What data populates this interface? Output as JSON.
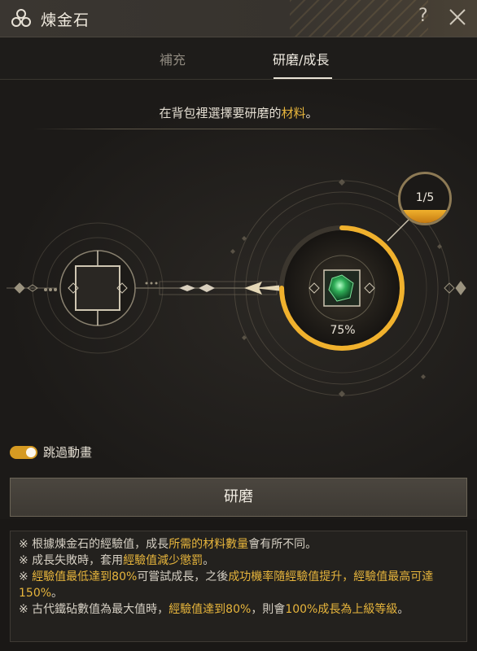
{
  "window": {
    "title": "煉金石",
    "help_label": "?",
    "icon": "alchemy-triskelion-icon"
  },
  "tabs": [
    {
      "label": "補充",
      "active": false
    },
    {
      "label": "研磨/成長",
      "active": true
    }
  ],
  "instruction": {
    "before": "在背包裡選擇要研磨的",
    "highlight": "材料",
    "after": "。"
  },
  "progress": {
    "label": "75%",
    "value": 0.75
  },
  "badge": {
    "label": "1/5",
    "fill": 0.2
  },
  "toggle": {
    "label": "跳過動畫",
    "on": true
  },
  "grind_button": {
    "label": "研磨"
  },
  "notes": [
    [
      {
        "t": "※ 根據煉金石的經驗值，成長"
      },
      {
        "t": "所需的材料數量",
        "hl": true
      },
      {
        "t": "會有所不同。"
      }
    ],
    [
      {
        "t": "※ 成長失敗時，套用"
      },
      {
        "t": "經驗值減少懲罰",
        "hl": true
      },
      {
        "t": "。"
      }
    ],
    [
      {
        "t": "※ "
      },
      {
        "t": "經驗值最低達到80%",
        "hl": true
      },
      {
        "t": "可嘗試成長，之後"
      },
      {
        "t": "成功機率隨經驗值提升，經驗值最高可達150%",
        "hl": true
      },
      {
        "t": "。"
      }
    ],
    [
      {
        "t": "※ 古代鐵砧數值為最大值時，"
      },
      {
        "t": "經驗值達到80%",
        "hl": true
      },
      {
        "t": "，則會"
      },
      {
        "t": "100%成長為上級等級",
        "hl": true
      },
      {
        "t": "。"
      }
    ]
  ],
  "colors": {
    "accent": "#e7b53c",
    "gem": "#2fae57",
    "ring": "#f0b12d"
  }
}
